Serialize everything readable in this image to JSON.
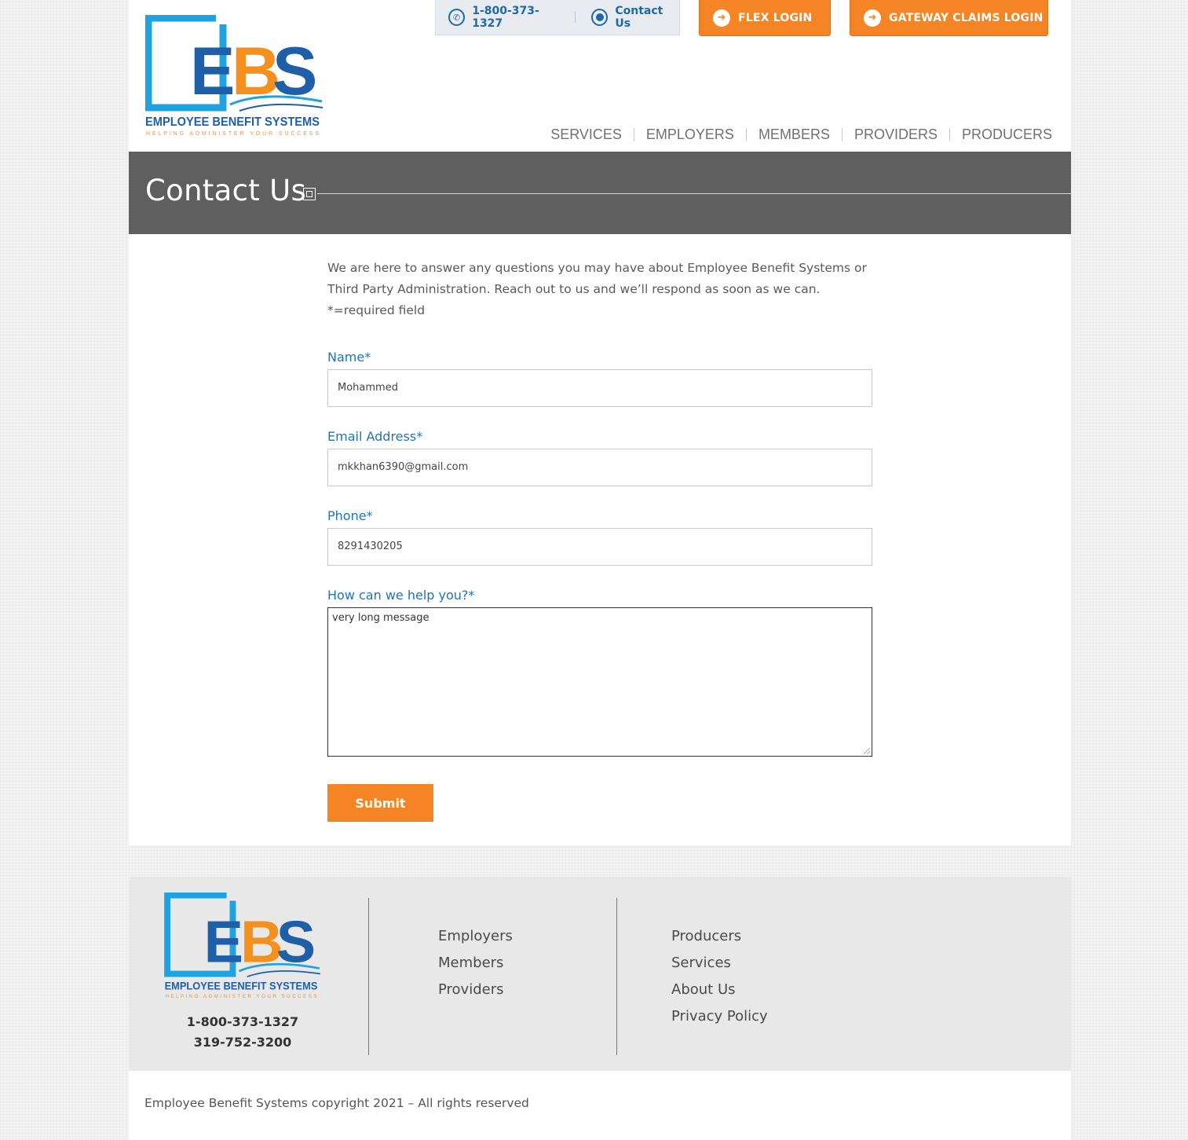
{
  "brand": {
    "logo_letters": [
      "E",
      "B",
      "S"
    ],
    "logo_name": "EMPLOYEE BENEFIT SYSTEMS",
    "logo_tagline": "HELPING ADMINISTER YOUR SUCCESS",
    "colors": {
      "blue": "#1f5fa8",
      "cyan": "#1ea3e0",
      "orange": "#f5901e"
    }
  },
  "topbar": {
    "phone": "1-800-373-1327",
    "contact": "Contact Us",
    "flex_login": "FLEX LOGIN",
    "gateway_login": "GATEWAY CLAIMS LOGIN"
  },
  "nav": [
    "SERVICES",
    "EMPLOYERS",
    "MEMBERS",
    "PROVIDERS",
    "PRODUCERS"
  ],
  "page": {
    "title": "Contact Us"
  },
  "form": {
    "intro": "We are here to answer any questions you may have about Employee Benefit Systems or Third Party Administration. Reach out to us and we’ll respond as soon as we can. *=required field",
    "name_label": "Name*",
    "name_value": "Mohammed",
    "email_label": "Email Address*",
    "email_value": "mkkhan6390@gmail.com",
    "phone_label": "Phone*",
    "phone_value": "8291430205",
    "message_label": "How can we help you?*",
    "message_value": "very long message",
    "submit_label": "Submit"
  },
  "footer": {
    "phone1": "1-800-373-1327",
    "phone2": "319-752-3200",
    "links_col1": [
      "Employers",
      "Members",
      "Providers"
    ],
    "links_col2": [
      "Producers",
      "Services",
      "About Us",
      "Privacy Policy"
    ],
    "copyright": "Employee Benefit Systems copyright 2021 – All rights reserved"
  },
  "accent_color": "#f58524",
  "label_color": "#1f74b3"
}
